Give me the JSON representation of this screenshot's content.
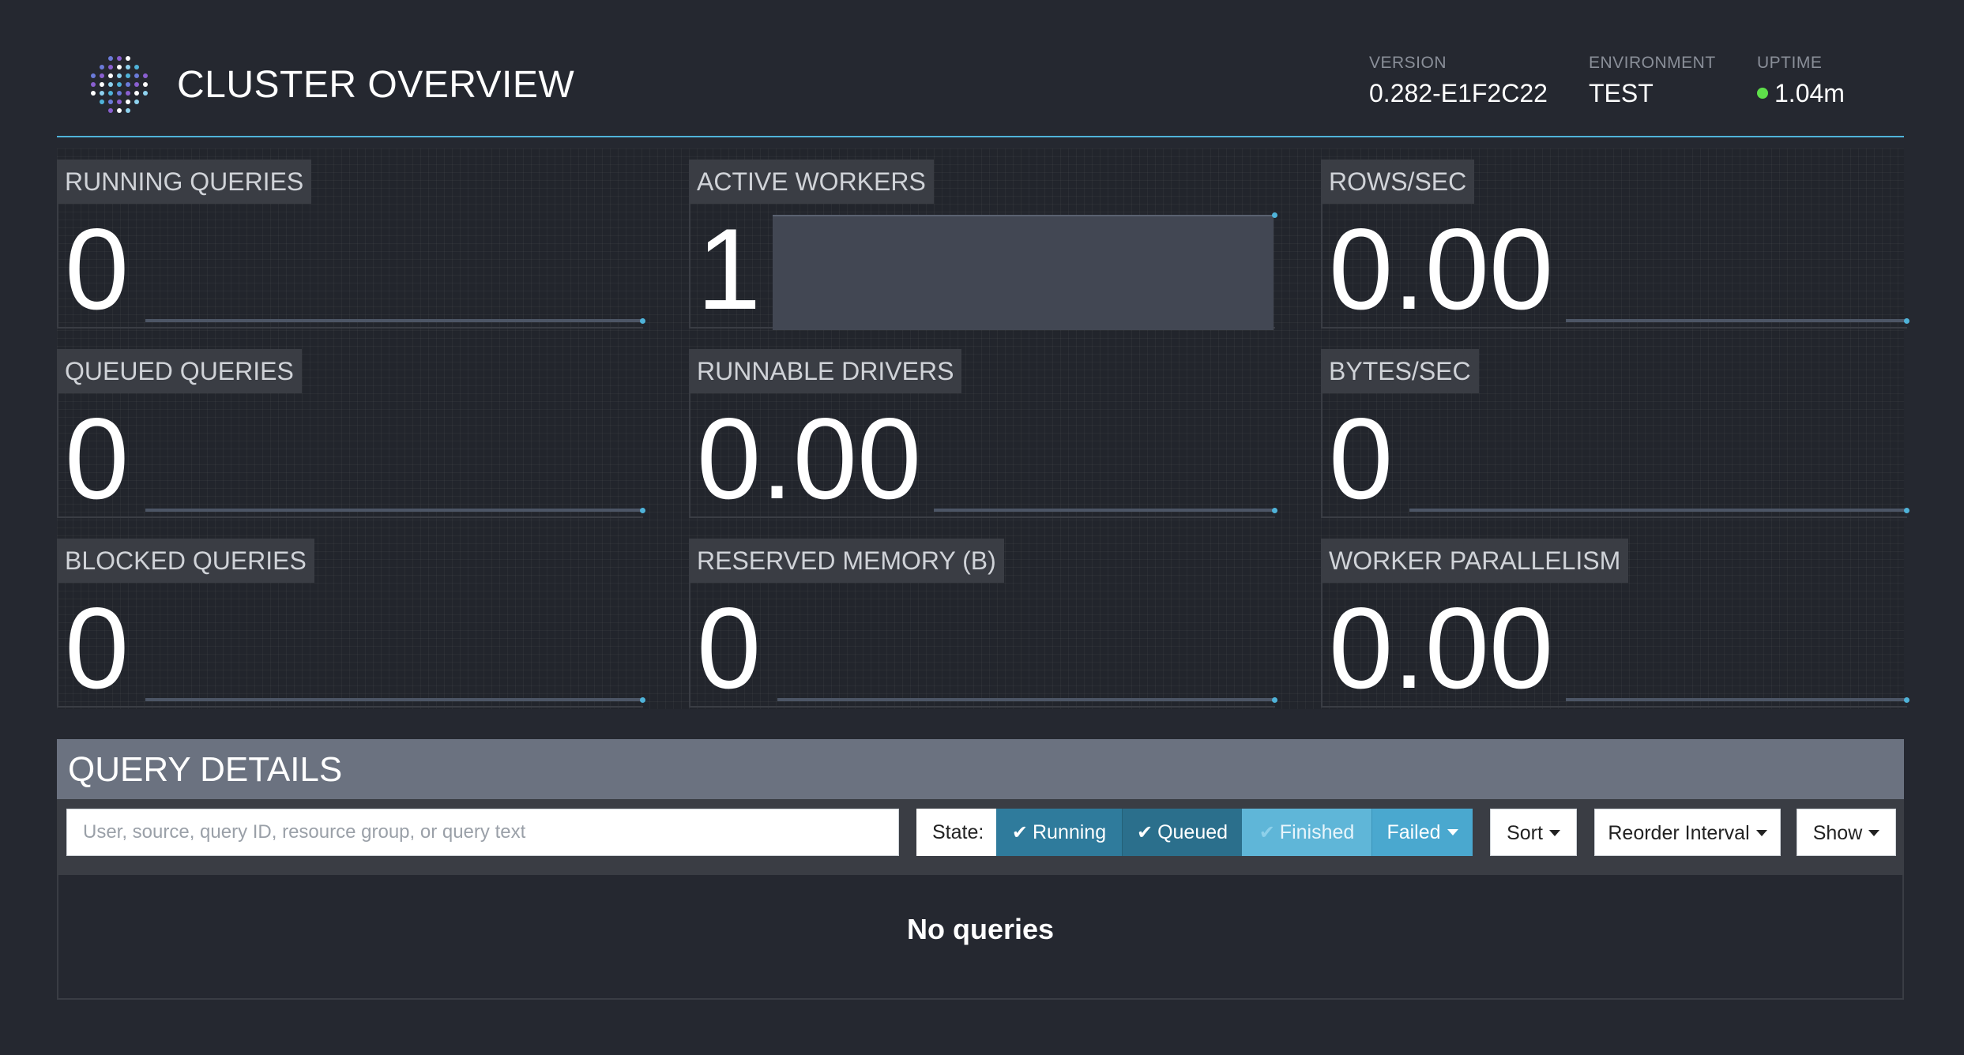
{
  "header": {
    "title": "CLUSTER OVERVIEW",
    "version_label": "VERSION",
    "version_value": "0.282-E1F2C22",
    "environment_label": "ENVIRONMENT",
    "environment_value": "TEST",
    "uptime_label": "UPTIME",
    "uptime_value": "1.04m",
    "uptime_status_color": "#5ee04a",
    "logo_icon": "presto-logo-icon"
  },
  "metrics": {
    "running_queries": {
      "label": "RUNNING QUERIES",
      "value": "0"
    },
    "active_workers": {
      "label": "ACTIVE WORKERS",
      "value": "1"
    },
    "rows_sec": {
      "label": "ROWS/SEC",
      "value": "0.00"
    },
    "queued_queries": {
      "label": "QUEUED QUERIES",
      "value": "0"
    },
    "runnable_drivers": {
      "label": "RUNNABLE DRIVERS",
      "value": "0.00"
    },
    "bytes_sec": {
      "label": "BYTES/SEC",
      "value": "0"
    },
    "blocked_queries": {
      "label": "BLOCKED QUERIES",
      "value": "0"
    },
    "reserved_memory": {
      "label": "RESERVED MEMORY (B)",
      "value": "0"
    },
    "worker_parallelism": {
      "label": "WORKER PARALLELISM",
      "value": "0.00"
    }
  },
  "query_details": {
    "title": "QUERY DETAILS",
    "search_placeholder": "User, source, query ID, resource group, or query text",
    "search_value": "",
    "state_label": "State:",
    "state_filters": [
      {
        "label": "Running",
        "checked": true
      },
      {
        "label": "Queued",
        "checked": true
      },
      {
        "label": "Finished",
        "checked": false
      },
      {
        "label": "Failed",
        "checked": false
      }
    ],
    "sort_label": "Sort",
    "reorder_label": "Reorder Interval",
    "show_label": "Show",
    "empty_message": "No queries"
  },
  "colors": {
    "background": "#252830",
    "accent": "#4fb3d9",
    "filter_active": "#2f7b9c",
    "filter_inactive": "#5fb6d8",
    "section_header": "#6b7280"
  }
}
